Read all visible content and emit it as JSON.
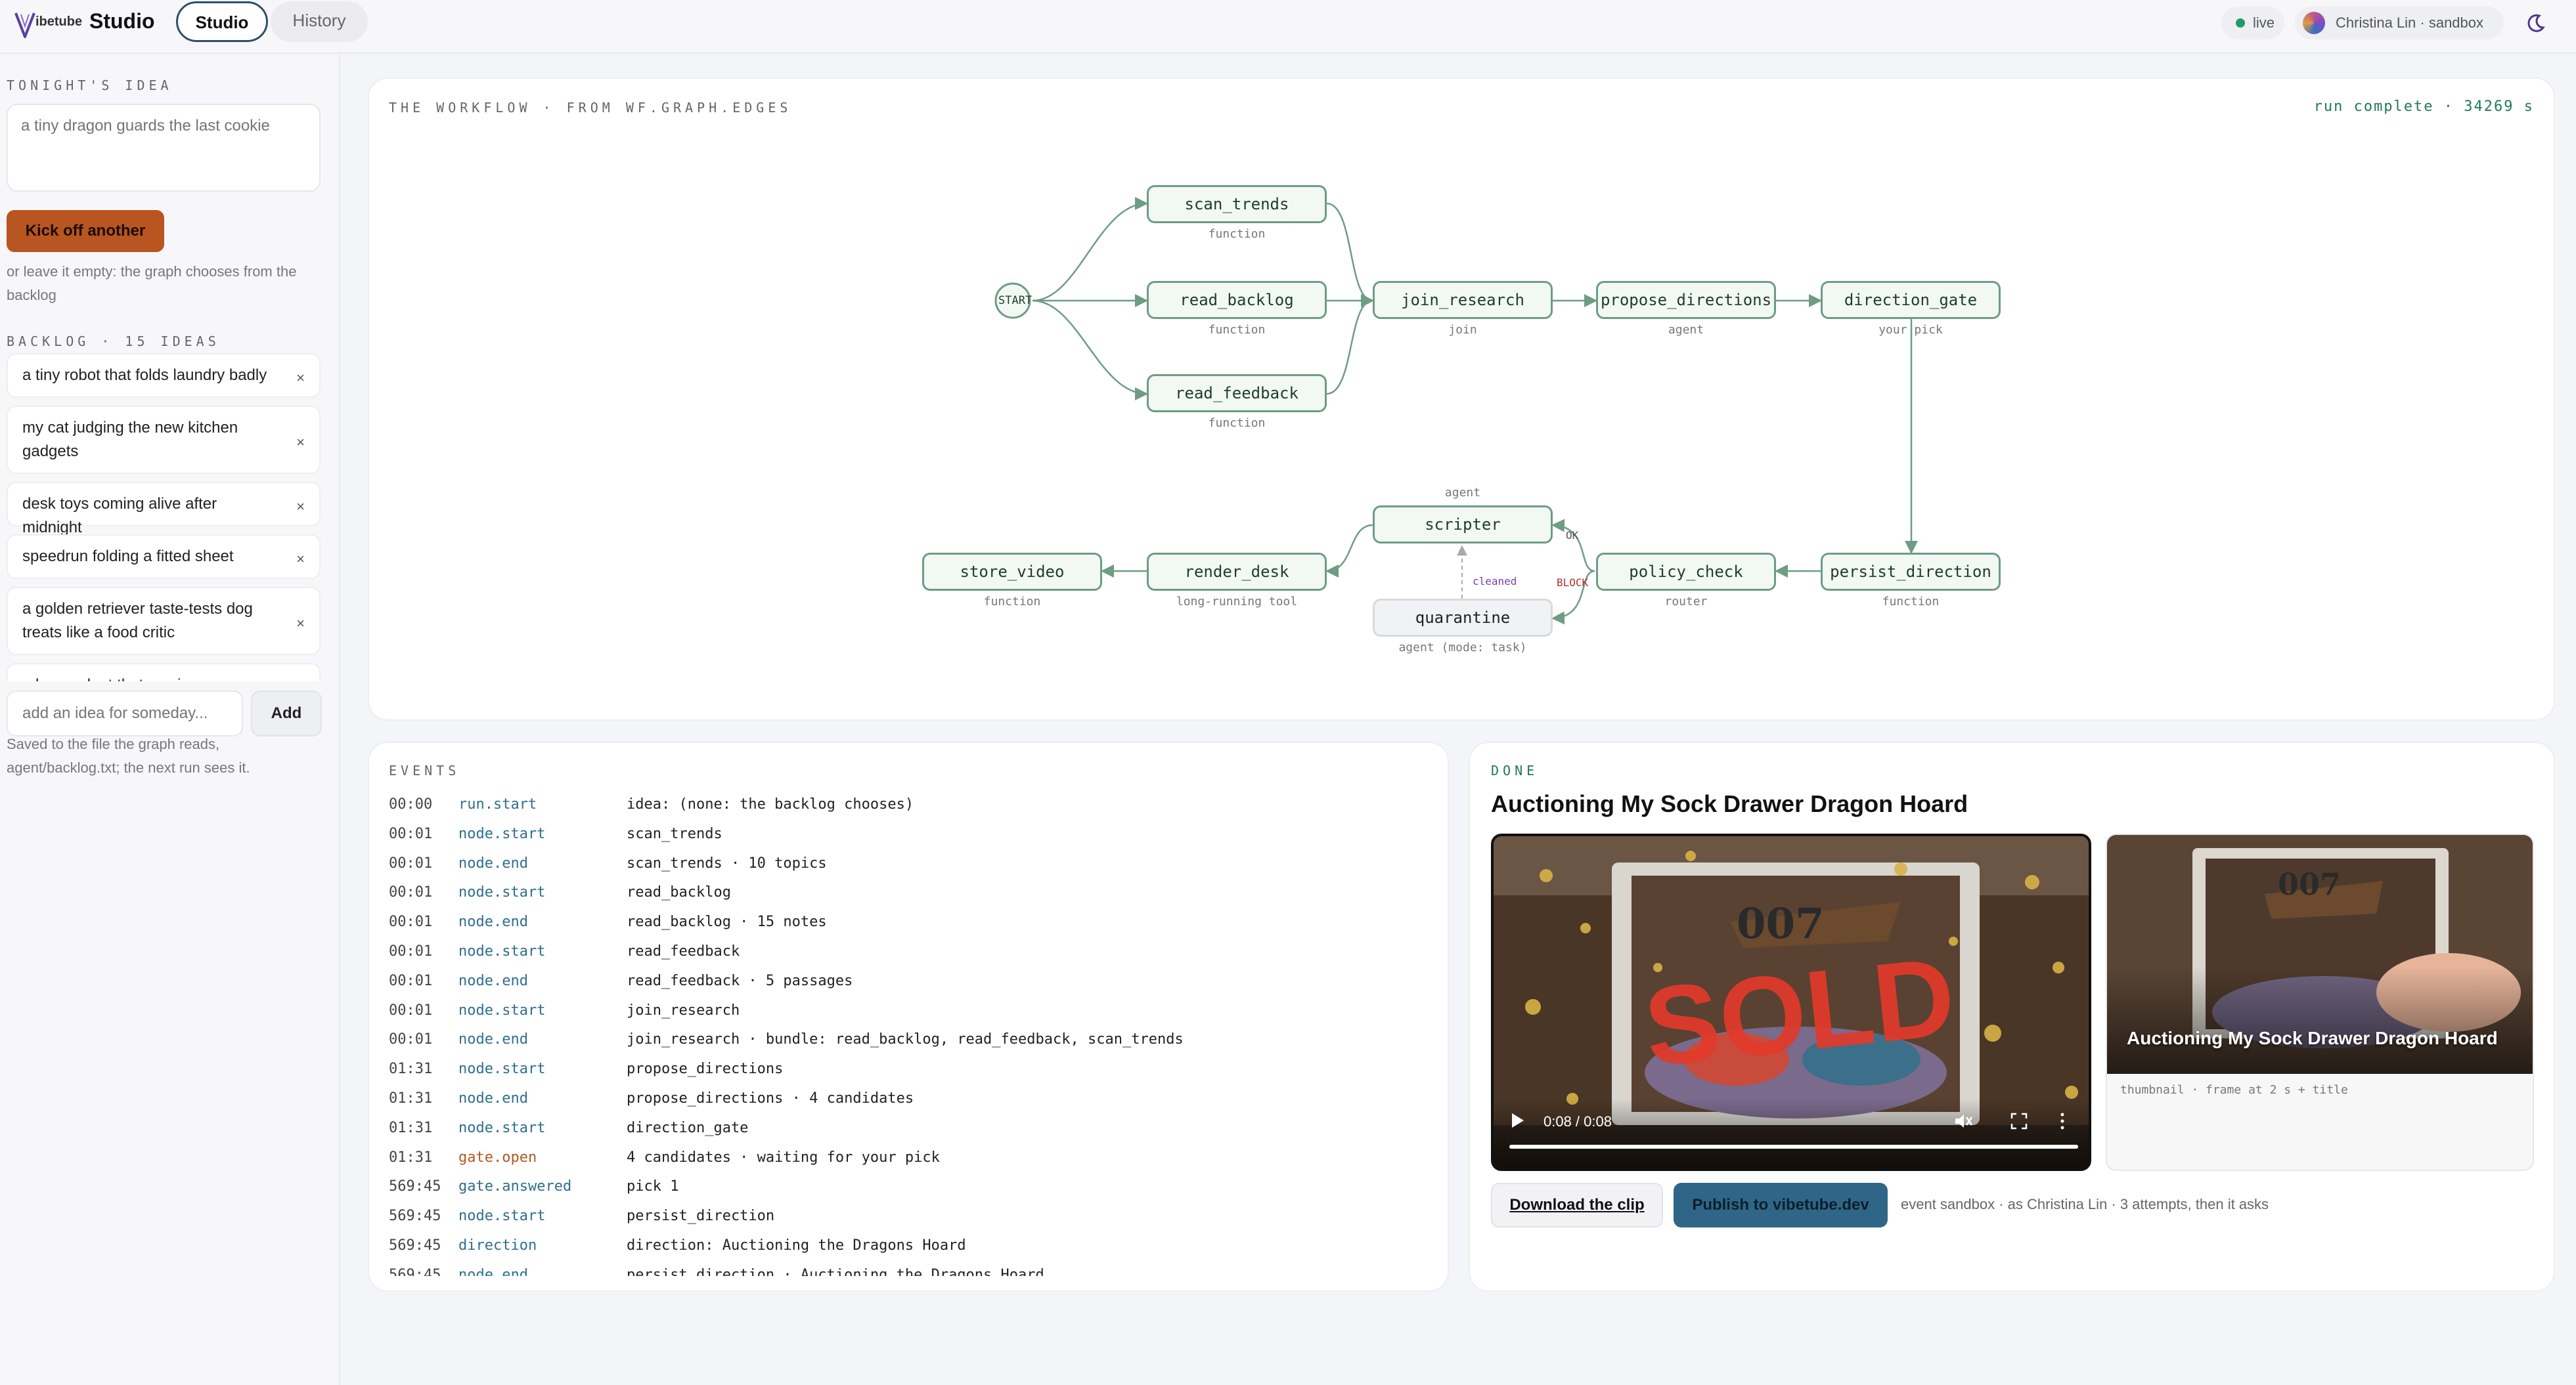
{
  "header": {
    "logo_text": "ibetube",
    "app_title": "Studio",
    "tabs": [
      {
        "label": "Studio",
        "active": true
      },
      {
        "label": "History",
        "active": false
      }
    ],
    "live_label": "live",
    "user_label": "Christina Lin · sandbox"
  },
  "sidebar": {
    "idea_label": "TONIGHT'S IDEA",
    "idea_placeholder": "a tiny dragon guards the last cookie",
    "kick_button": "Kick off another",
    "empty_help": "or leave it empty: the graph chooses from the backlog",
    "backlog_label": "BACKLOG · 15 IDEAS",
    "backlog_items": [
      "a tiny robot that folds laundry badly",
      "my cat judging the new kitchen gadgets",
      "desk toys coming alive after midnight",
      "speedrun folding a fitted sheet",
      "a golden retriever taste-tests dog treats like a food critic",
      "a houseplant that survives"
    ],
    "remove_glyph": "×",
    "add_placeholder": "add an idea for someday...",
    "add_button": "Add",
    "saved_help": "Saved to the file the graph reads, agent/backlog.txt; the next run sees it."
  },
  "workflow": {
    "label": "THE WORKFLOW · FROM WF.GRAPH.EDGES",
    "status": "run complete · 34269 s",
    "start_label": "START",
    "nodes": {
      "scan_trends": {
        "label": "scan_trends",
        "kind": "function"
      },
      "read_backlog": {
        "label": "read_backlog",
        "kind": "function"
      },
      "read_feedback": {
        "label": "read_feedback",
        "kind": "function"
      },
      "join_research": {
        "label": "join_research",
        "kind": "join"
      },
      "propose_directions": {
        "label": "propose_directions",
        "kind": "agent"
      },
      "direction_gate": {
        "label": "direction_gate",
        "kind": "your pick"
      },
      "persist_direction": {
        "label": "persist_direction",
        "kind": "function"
      },
      "policy_check": {
        "label": "policy_check",
        "kind": "router"
      },
      "scripter": {
        "label": "scripter",
        "kind": "agent"
      },
      "quarantine": {
        "label": "quarantine",
        "kind": "agent (mode: task)"
      },
      "render_desk": {
        "label": "render_desk",
        "kind": "long-running tool"
      },
      "store_video": {
        "label": "store_video",
        "kind": "function"
      }
    },
    "edge_labels": {
      "ok": "OK",
      "block": "BLOCK",
      "cleaned": "cleaned"
    },
    "colors": {
      "node_border": "#6e9c84",
      "node_fill": "#f2f8f4",
      "block": "#b03030",
      "cleaned": "#7b3fa8"
    }
  },
  "events": {
    "label": "EVENTS",
    "rows": [
      {
        "time": "00:00",
        "kind": "run.start",
        "detail": "idea: (none: the backlog chooses)"
      },
      {
        "time": "00:01",
        "kind": "node.start",
        "detail": "scan_trends"
      },
      {
        "time": "00:01",
        "kind": "node.end",
        "detail": "scan_trends · 10 topics"
      },
      {
        "time": "00:01",
        "kind": "node.start",
        "detail": "read_backlog"
      },
      {
        "time": "00:01",
        "kind": "node.end",
        "detail": "read_backlog · 15 notes"
      },
      {
        "time": "00:01",
        "kind": "node.start",
        "detail": "read_feedback"
      },
      {
        "time": "00:01",
        "kind": "node.end",
        "detail": "read_feedback · 5 passages"
      },
      {
        "time": "00:01",
        "kind": "node.start",
        "detail": "join_research"
      },
      {
        "time": "00:01",
        "kind": "node.end",
        "detail": "join_research · bundle: read_backlog, read_feedback, scan_trends"
      },
      {
        "time": "01:31",
        "kind": "node.start",
        "detail": "propose_directions"
      },
      {
        "time": "01:31",
        "kind": "node.end",
        "detail": "propose_directions · 4 candidates"
      },
      {
        "time": "01:31",
        "kind": "node.start",
        "detail": "direction_gate"
      },
      {
        "time": "01:31",
        "kind": "gate.open",
        "detail": "4 candidates · waiting for your pick"
      },
      {
        "time": "569:45",
        "kind": "gate.answered",
        "detail": "pick 1"
      },
      {
        "time": "569:45",
        "kind": "node.start",
        "detail": "persist_direction"
      },
      {
        "time": "569:45",
        "kind": "direction",
        "detail": "direction: Auctioning the Dragons Hoard"
      },
      {
        "time": "569:45",
        "kind": "node.end",
        "detail": "persist_direction · Auctioning the Dragons Hoard"
      }
    ]
  },
  "done": {
    "label": "DONE",
    "title": "Auctioning My Sock Drawer Dragon Hoard",
    "video_time": "0:08 / 0:08",
    "video_progress": 1.0,
    "thumb_title": "Auctioning My Sock Drawer Dragon Hoard",
    "thumb_caption": "thumbnail · frame at 2 s + title",
    "download_button": "Download the clip",
    "publish_button": "Publish to vibetube.dev",
    "publish_note": "event sandbox · as Christina Lin · 3 attempts, then it asks",
    "box_number": "007",
    "overlay_text": "SOLD"
  }
}
